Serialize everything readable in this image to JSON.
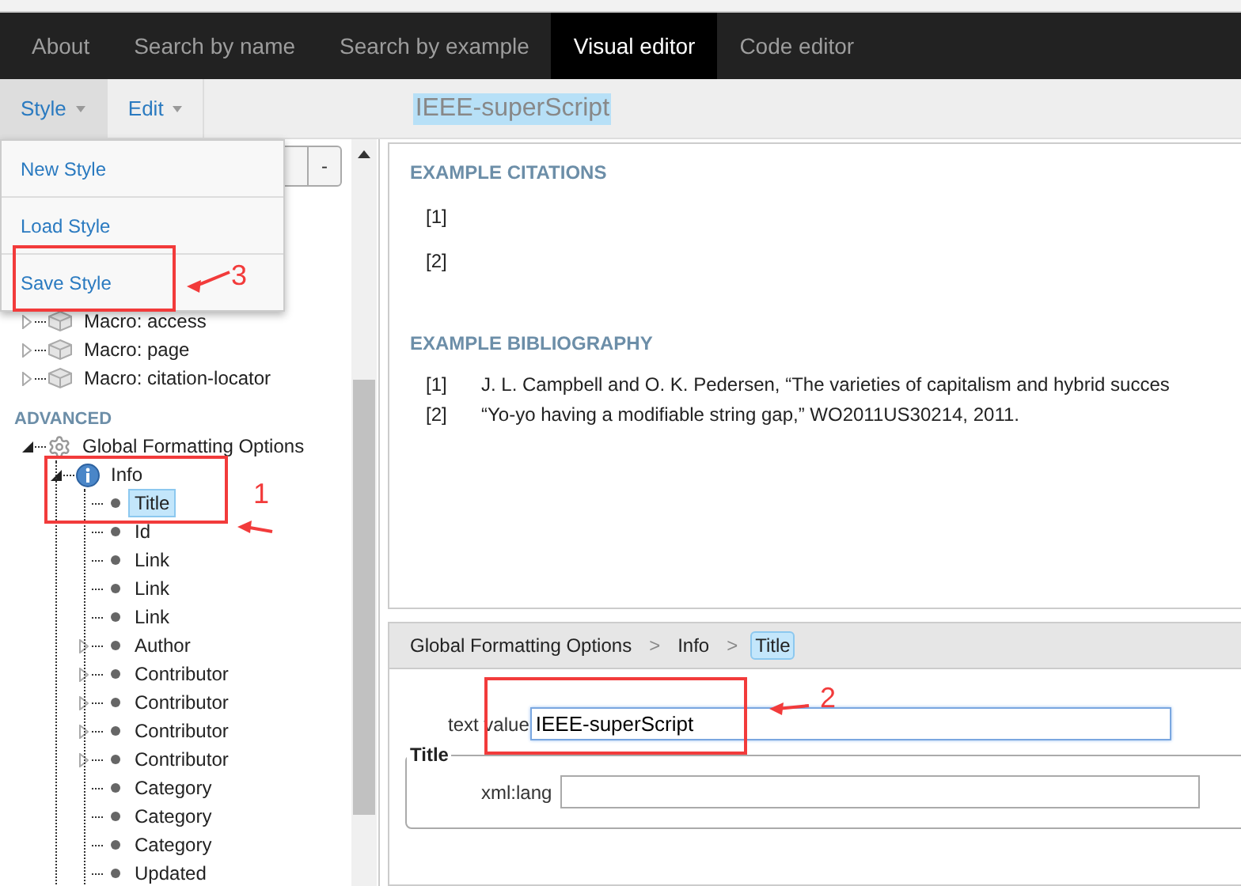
{
  "nav": {
    "tabs": [
      {
        "label": "About",
        "selected": false
      },
      {
        "label": "Search by name",
        "selected": false
      },
      {
        "label": "Search by example",
        "selected": false
      },
      {
        "label": "Visual editor",
        "selected": true
      },
      {
        "label": "Code editor",
        "selected": false
      }
    ]
  },
  "toolbar": {
    "menus": [
      {
        "label": "Style",
        "open": true
      },
      {
        "label": "Edit",
        "open": false
      }
    ],
    "style_name": "IEEE-superScript"
  },
  "style_menu": {
    "items": [
      "New Style",
      "Load Style",
      "Save Style"
    ]
  },
  "tree_buttons": [
    "-"
  ],
  "tree": {
    "items": [
      {
        "label": "Macro: access",
        "kind": "macro",
        "expanded": false,
        "selected": false
      },
      {
        "label": "Macro: page",
        "kind": "macro",
        "expanded": false,
        "selected": false
      },
      {
        "label": "Macro: citation-locator",
        "kind": "macro",
        "expanded": false,
        "selected": false
      }
    ],
    "advanced_heading": "ADVANCED",
    "advanced_items": [
      {
        "label": "Global Formatting Options",
        "kind": "gear",
        "expanded": true,
        "selected": false,
        "children": [
          {
            "label": "Info",
            "kind": "info",
            "expanded": true,
            "selected": false,
            "children": [
              {
                "label": "Title",
                "kind": "property",
                "selected": true
              },
              {
                "label": "Id",
                "kind": "property",
                "selected": false
              },
              {
                "label": "Link",
                "kind": "property",
                "selected": false
              },
              {
                "label": "Link",
                "kind": "property",
                "selected": false
              },
              {
                "label": "Link",
                "kind": "property",
                "selected": false
              },
              {
                "label": "Author",
                "kind": "property",
                "expanded": false,
                "selected": false
              },
              {
                "label": "Contributor",
                "kind": "property",
                "expanded": false,
                "selected": false
              },
              {
                "label": "Contributor",
                "kind": "property",
                "expanded": false,
                "selected": false
              },
              {
                "label": "Contributor",
                "kind": "property",
                "expanded": false,
                "selected": false
              },
              {
                "label": "Contributor",
                "kind": "property",
                "expanded": false,
                "selected": false
              },
              {
                "label": "Category",
                "kind": "property",
                "selected": false
              },
              {
                "label": "Category",
                "kind": "property",
                "selected": false
              },
              {
                "label": "Category",
                "kind": "property",
                "selected": false
              },
              {
                "label": "Updated",
                "kind": "property",
                "selected": false
              }
            ]
          }
        ]
      }
    ]
  },
  "preview": {
    "citations_heading": "EXAMPLE CITATIONS",
    "citations": [
      "[1]",
      "[2]"
    ],
    "bibliography_heading": "EXAMPLE BIBLIOGRAPHY",
    "bibliography": [
      {
        "number": "[1]",
        "text": "J. L. Campbell and O. K. Pedersen, “The varieties of capitalism and hybrid succes"
      },
      {
        "number": "[2]",
        "text": "“Yo-yo having a modifiable string gap,” WO2011US30214, 2011."
      }
    ]
  },
  "editor": {
    "breadcrumb": [
      {
        "kind": "crumb",
        "label": "Global Formatting Options",
        "selected": false
      },
      {
        "kind": "separator",
        "label": ">"
      },
      {
        "kind": "crumb",
        "label": "Info",
        "selected": false
      },
      {
        "kind": "separator",
        "label": ">"
      },
      {
        "kind": "crumb",
        "label": "Title",
        "selected": true
      }
    ],
    "text_value": {
      "label": "text value",
      "value": "IEEE-superScript",
      "focused": true
    },
    "fieldset": {
      "legend": "Title",
      "field": {
        "label": "xml:lang"
      }
    }
  },
  "annotations": [
    {
      "label": "3"
    },
    {
      "label": "1"
    },
    {
      "label": "2"
    }
  ]
}
